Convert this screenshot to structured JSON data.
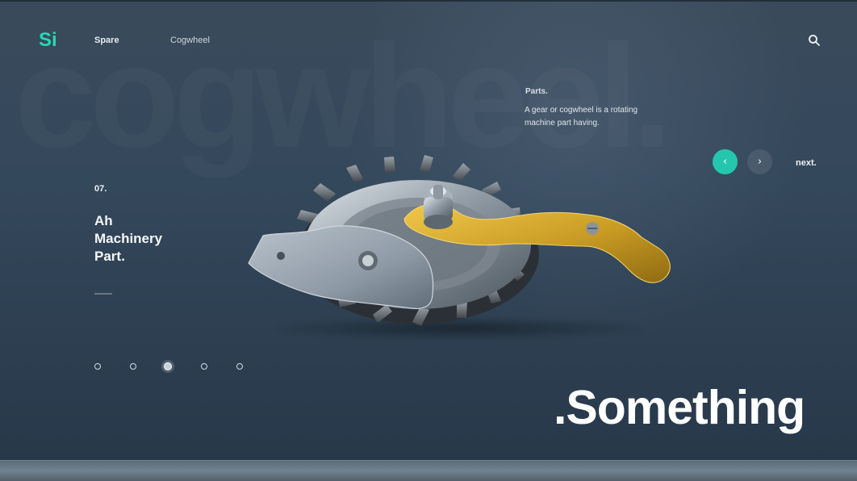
{
  "brand": {
    "logo_text": "Si",
    "accent_color": "#24c7ad"
  },
  "header": {
    "nav_items": [
      "Spare",
      "Cogwheel"
    ],
    "search_icon": "search-icon"
  },
  "background": {
    "watermark_text": "cogwheel."
  },
  "info": {
    "title": "Parts.",
    "description": "A gear or cogwheel is a rotating machine part having."
  },
  "carousel": {
    "prev_icon": "chevron-left-icon",
    "next_icon": "chevron-right-icon",
    "next_label": "next.",
    "slide_number": "07.",
    "headline_lines": [
      "Ah",
      "Machinery",
      "Part."
    ],
    "pagination_count": 5,
    "active_index": 2
  },
  "hero": {
    "title": ".Something"
  },
  "colors": {
    "background_top": "#3a4a5b",
    "background_bottom": "#263748",
    "text": "#ffffff",
    "muted_text": "#dfe6ea",
    "gold": "#c99b24"
  }
}
